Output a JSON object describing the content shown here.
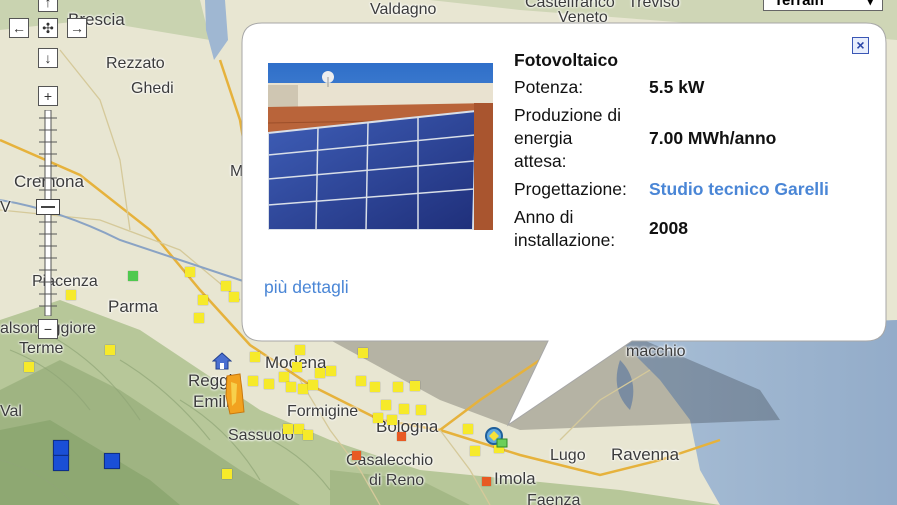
{
  "map": {
    "places": {
      "brescia": "Brescia",
      "valdagno": "Valdagno",
      "castelfranco": "Castelfranco",
      "treviso": "Treviso",
      "veneto": "Veneto",
      "rezzato": "Rezzato",
      "ghedi": "Ghedi",
      "cremona": "Cremona",
      "piacenza": "Piacenza",
      "parma": "Parma",
      "salsomaggiore": "alsomaggiore",
      "terme": "Terme",
      "modena": "Modena",
      "reggio": "Reggio",
      "emilia": "Emilia",
      "formigine": "Formigine",
      "sassuolo": "Sassuolo",
      "bologna": "Bologna",
      "casalecchio": "Casalecchio",
      "di_reno": "di Reno",
      "imola": "Imola",
      "faenza": "Faenza",
      "lugo": "Lugo",
      "ravenna": "Ravenna",
      "comacchio": "macchio",
      "val": "Val",
      "v": "V",
      "m": "M"
    },
    "map_type": "Terrain"
  },
  "popup": {
    "title": "Fotovoltaico",
    "rows": {
      "potenza_label": "Potenza:",
      "potenza_value": "5.5 kW",
      "produzione_label_1": "Produzione di",
      "produzione_label_2": "energia",
      "produzione_label_3": "attesa:",
      "produzione_value": "7.00 MWh/anno",
      "progettazione_label": "Progettazione:",
      "progettazione_value": "Studio tecnico Garelli",
      "anno_label_1": "Anno di",
      "anno_label_2": "installazione:",
      "anno_value": "2008"
    },
    "details_link": "più dettagli"
  },
  "colors": {
    "link": "#4a86d6",
    "marker_yellow": "#f6ea2a",
    "marker_green": "#4fc94f",
    "marker_red": "#e85a23",
    "marker_blue": "#1a4fd6"
  }
}
